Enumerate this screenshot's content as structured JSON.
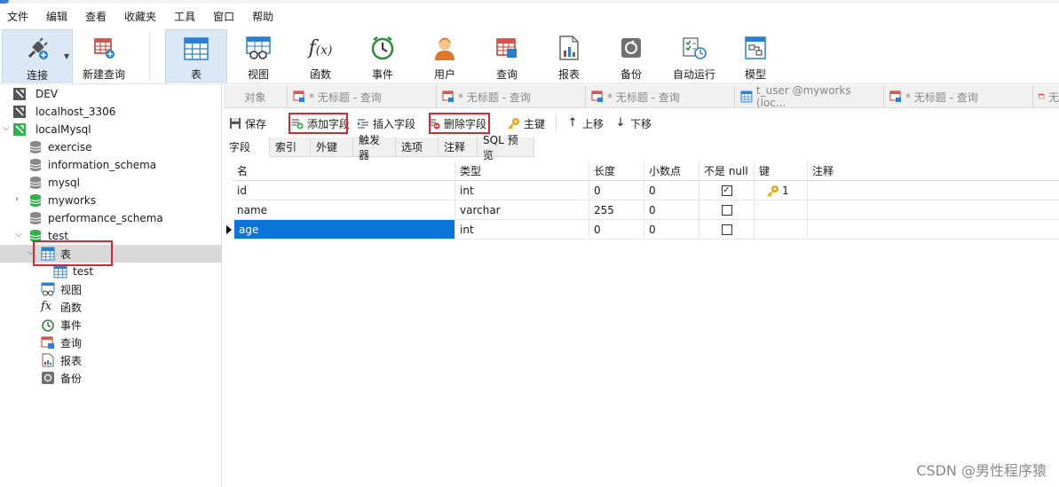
{
  "menu": [
    "文件",
    "编辑",
    "查看",
    "收藏夹",
    "工具",
    "窗口",
    "帮助"
  ],
  "toolbar": {
    "connect": "连接",
    "new_query": "新建查询",
    "table": "表",
    "view": "视图",
    "function": "函数",
    "event": "事件",
    "user": "用户",
    "query": "查询",
    "report": "报表",
    "backup": "备份",
    "autorun": "自动运行",
    "model": "模型"
  },
  "sidebar": {
    "items": [
      {
        "label": "DEV"
      },
      {
        "label": "localhost_3306"
      },
      {
        "label": "localMysql"
      },
      {
        "label": "exercise"
      },
      {
        "label": "information_schema"
      },
      {
        "label": "mysql"
      },
      {
        "label": "myworks"
      },
      {
        "label": "performance_schema"
      },
      {
        "label": "test"
      },
      {
        "label": "表"
      },
      {
        "label": "test"
      },
      {
        "label": "视图"
      },
      {
        "label": "函数"
      },
      {
        "label": "事件"
      },
      {
        "label": "查询"
      },
      {
        "label": "报表"
      },
      {
        "label": "备份"
      }
    ]
  },
  "tabs": [
    {
      "label": "对象"
    },
    {
      "label": "* 无标题 - 查询"
    },
    {
      "label": "* 无标题 - 查询"
    },
    {
      "label": "* 无标题 - 查询"
    },
    {
      "label": "t_user @myworks (loc..."
    },
    {
      "label": "* 无标题 - 查询"
    },
    {
      "label": "无"
    }
  ],
  "obj_toolbar": {
    "save": "保存",
    "add_field": "添加字段",
    "insert_field": "插入字段",
    "delete_field": "删除字段",
    "primary_key": "主键",
    "move_up": "上移",
    "move_down": "下移"
  },
  "sub_tabs": [
    "字段",
    "索引",
    "外键",
    "触发器",
    "选项",
    "注释",
    "SQL 预览"
  ],
  "grid": {
    "headers": [
      "名",
      "类型",
      "长度",
      "小数点",
      "不是 null",
      "键",
      "注释"
    ],
    "rows": [
      {
        "name": "id",
        "type": "int",
        "length": "0",
        "decimals": "0",
        "not_null": true,
        "key": "1"
      },
      {
        "name": "name",
        "type": "varchar",
        "length": "255",
        "decimals": "0",
        "not_null": false,
        "key": ""
      },
      {
        "name": "age",
        "type": "int",
        "length": "0",
        "decimals": "0",
        "not_null": false,
        "key": ""
      }
    ]
  },
  "watermark": "CSDN @男性程序猿",
  "colors": {
    "accent": "#0a74d8",
    "highlight_box": "#e0232f",
    "db_green": "#2fb24a"
  }
}
